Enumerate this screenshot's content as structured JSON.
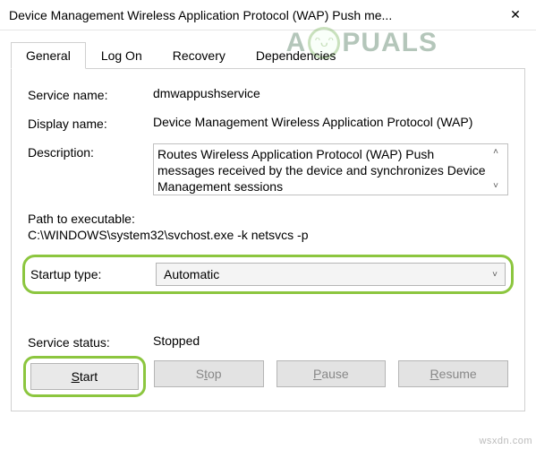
{
  "titlebar": {
    "title": "Device Management Wireless Application Protocol (WAP) Push me..."
  },
  "tabs": [
    "General",
    "Log On",
    "Recovery",
    "Dependencies"
  ],
  "labels": {
    "service_name": "Service name:",
    "display_name": "Display name:",
    "description": "Description:",
    "path_label": "Path to executable:",
    "startup_type": "Startup type:",
    "service_status": "Service status:"
  },
  "values": {
    "service_name": "dmwappushservice",
    "display_name": "Device Management Wireless Application Protocol (WAP)",
    "description": "Routes Wireless Application Protocol (WAP) Push messages received by the device and synchronizes Device Management sessions",
    "path": "C:\\WINDOWS\\system32\\svchost.exe -k netsvcs -p",
    "startup_type": "Automatic",
    "service_status": "Stopped"
  },
  "buttons": {
    "start": "Start",
    "stop": "Stop",
    "pause": "Pause",
    "resume": "Resume"
  },
  "watermark": "wsxdn.com",
  "logo": {
    "left": "A",
    "right": "PUALS"
  }
}
